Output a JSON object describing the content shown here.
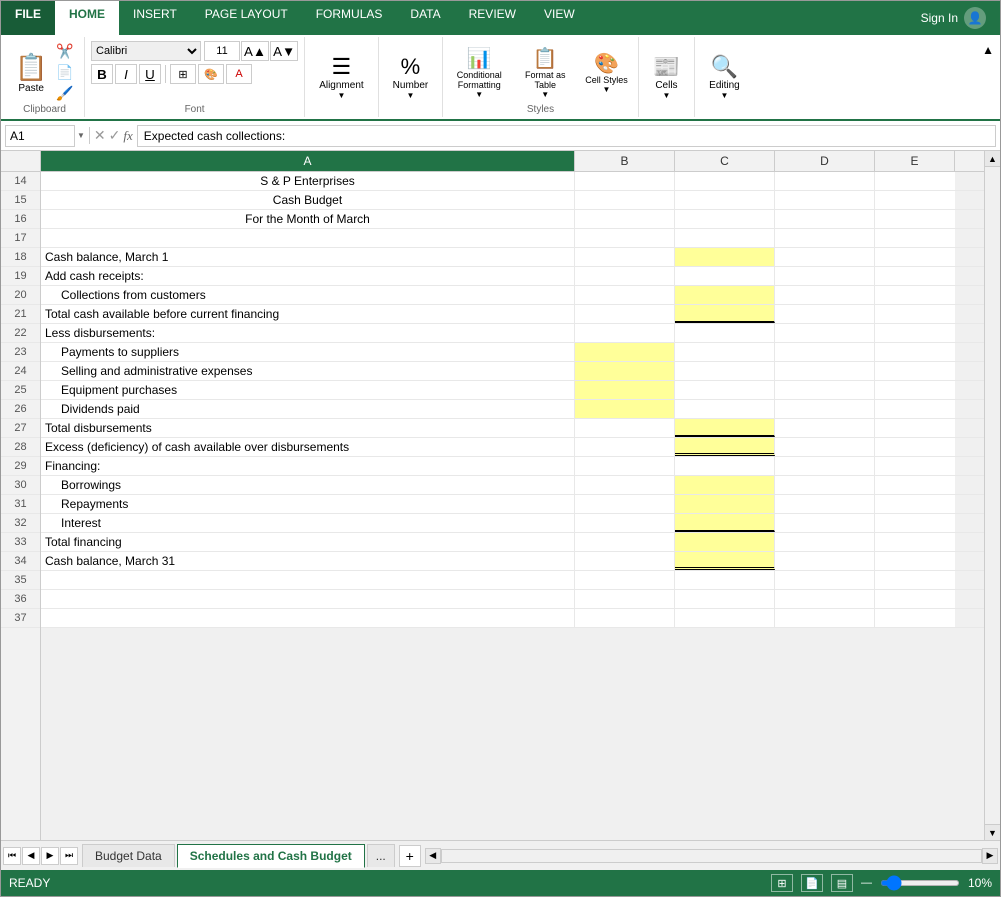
{
  "ribbon": {
    "tabs": [
      "FILE",
      "HOME",
      "INSERT",
      "PAGE LAYOUT",
      "FORMULAS",
      "DATA",
      "REVIEW",
      "VIEW"
    ],
    "active_tab": "HOME",
    "file_tab": "FILE",
    "sign_in": "Sign In",
    "clipboard_label": "Clipboard",
    "font_label": "Font",
    "styles_label": "Styles",
    "cells_label": "Cells",
    "editing_label": "Editing",
    "font_name": "Calibri",
    "font_size": "11",
    "alignment_btn": "Alignment",
    "number_btn": "Number",
    "conditional_formatting_btn": "Conditional Formatting",
    "format_as_table_btn": "Format as Table",
    "cell_styles_btn": "Cell Styles",
    "cells_btn": "Cells",
    "editing_btn": "Editing"
  },
  "formula_bar": {
    "cell_ref": "A1",
    "formula": "Expected cash collections:"
  },
  "columns": [
    "A",
    "B",
    "C",
    "D",
    "E"
  ],
  "row_start": 14,
  "rows": [
    {
      "num": 14,
      "a": "S & P Enterprises",
      "b": "",
      "c": "",
      "d": "",
      "e": "",
      "a_align": "center",
      "a_indent": false,
      "c_yellow": false,
      "b_yellow": false
    },
    {
      "num": 15,
      "a": "Cash Budget",
      "b": "",
      "c": "",
      "d": "",
      "e": "",
      "a_align": "center",
      "a_indent": false,
      "c_yellow": false,
      "b_yellow": false
    },
    {
      "num": 16,
      "a": "For the Month of March",
      "b": "",
      "c": "",
      "d": "",
      "e": "",
      "a_align": "center",
      "a_indent": false,
      "c_yellow": false,
      "b_yellow": false
    },
    {
      "num": 17,
      "a": "",
      "b": "",
      "c": "",
      "d": "",
      "e": "",
      "a_align": "left",
      "a_indent": false,
      "c_yellow": false,
      "b_yellow": false
    },
    {
      "num": 18,
      "a": "Cash balance, March 1",
      "b": "",
      "c": "yellow",
      "d": "",
      "e": "",
      "a_align": "left",
      "a_indent": false,
      "c_yellow": true,
      "b_yellow": false
    },
    {
      "num": 19,
      "a": "Add cash receipts:",
      "b": "",
      "c": "",
      "d": "",
      "e": "",
      "a_align": "left",
      "a_indent": false,
      "c_yellow": false,
      "b_yellow": false
    },
    {
      "num": 20,
      "a": "  Collections from customers",
      "b": "",
      "c": "yellow",
      "d": "",
      "e": "",
      "a_align": "left",
      "a_indent": true,
      "c_yellow": true,
      "b_yellow": false
    },
    {
      "num": 21,
      "a": "Total cash available before current financing",
      "b": "",
      "c": "yellow",
      "d": "",
      "e": "",
      "a_align": "left",
      "a_indent": false,
      "c_yellow": true,
      "b_yellow": false,
      "c_border_bottom": true
    },
    {
      "num": 22,
      "a": "Less disbursements:",
      "b": "",
      "c": "",
      "d": "",
      "e": "",
      "a_align": "left",
      "a_indent": false,
      "c_yellow": false,
      "b_yellow": false
    },
    {
      "num": 23,
      "a": "  Payments to suppliers",
      "b": "yellow",
      "c": "",
      "d": "",
      "e": "",
      "a_align": "left",
      "a_indent": true,
      "c_yellow": false,
      "b_yellow": true
    },
    {
      "num": 24,
      "a": "  Selling and administrative expenses",
      "b": "yellow",
      "c": "",
      "d": "",
      "e": "",
      "a_align": "left",
      "a_indent": true,
      "c_yellow": false,
      "b_yellow": true
    },
    {
      "num": 25,
      "a": "  Equipment purchases",
      "b": "yellow",
      "c": "",
      "d": "",
      "e": "",
      "a_align": "left",
      "a_indent": true,
      "c_yellow": false,
      "b_yellow": true
    },
    {
      "num": 26,
      "a": "  Dividends paid",
      "b": "yellow",
      "c": "",
      "d": "",
      "e": "",
      "a_align": "left",
      "a_indent": true,
      "c_yellow": false,
      "b_yellow": true,
      "b_border_bottom": true
    },
    {
      "num": 27,
      "a": "Total disbursements",
      "b": "",
      "c": "yellow",
      "d": "",
      "e": "",
      "a_align": "left",
      "a_indent": false,
      "c_yellow": true,
      "b_yellow": false,
      "c_border_bottom": true
    },
    {
      "num": 28,
      "a": "Excess (deficiency) of cash available over disbursements",
      "b": "",
      "c": "yellow",
      "d": "",
      "e": "",
      "a_align": "left",
      "a_indent": false,
      "c_yellow": true,
      "b_yellow": false,
      "c_double_border": true
    },
    {
      "num": 29,
      "a": "Financing:",
      "b": "",
      "c": "",
      "d": "",
      "e": "",
      "a_align": "left",
      "a_indent": false,
      "c_yellow": false,
      "b_yellow": false
    },
    {
      "num": 30,
      "a": "  Borrowings",
      "b": "",
      "c": "yellow",
      "d": "",
      "e": "",
      "a_align": "left",
      "a_indent": true,
      "c_yellow": true,
      "b_yellow": false
    },
    {
      "num": 31,
      "a": "  Repayments",
      "b": "",
      "c": "yellow",
      "d": "",
      "e": "",
      "a_align": "left",
      "a_indent": true,
      "c_yellow": true,
      "b_yellow": false
    },
    {
      "num": 32,
      "a": "  Interest",
      "b": "",
      "c": "yellow",
      "d": "",
      "e": "",
      "a_align": "left",
      "a_indent": true,
      "c_yellow": true,
      "b_yellow": false,
      "c_border_bottom": true
    },
    {
      "num": 33,
      "a": "Total financing",
      "b": "",
      "c": "yellow",
      "d": "",
      "e": "",
      "a_align": "left",
      "a_indent": false,
      "c_yellow": true,
      "b_yellow": false
    },
    {
      "num": 34,
      "a": "Cash balance, March 31",
      "b": "",
      "c": "yellow",
      "d": "",
      "e": "",
      "a_align": "left",
      "a_indent": false,
      "c_yellow": true,
      "b_yellow": false,
      "c_double_border": true
    },
    {
      "num": 35,
      "a": "",
      "b": "",
      "c": "",
      "d": "",
      "e": "",
      "a_align": "left",
      "a_indent": false,
      "c_yellow": false,
      "b_yellow": false
    },
    {
      "num": 36,
      "a": "",
      "b": "",
      "c": "",
      "d": "",
      "e": "",
      "a_align": "left",
      "a_indent": false,
      "c_yellow": false,
      "b_yellow": false
    },
    {
      "num": 37,
      "a": "",
      "b": "",
      "c": "",
      "d": "",
      "e": "",
      "a_align": "left",
      "a_indent": false,
      "c_yellow": false,
      "b_yellow": false
    }
  ],
  "sheets": [
    {
      "name": "Budget Data",
      "active": false
    },
    {
      "name": "Schedules and Cash Budget",
      "active": true
    }
  ],
  "status": {
    "ready": "READY",
    "zoom": "10%"
  }
}
